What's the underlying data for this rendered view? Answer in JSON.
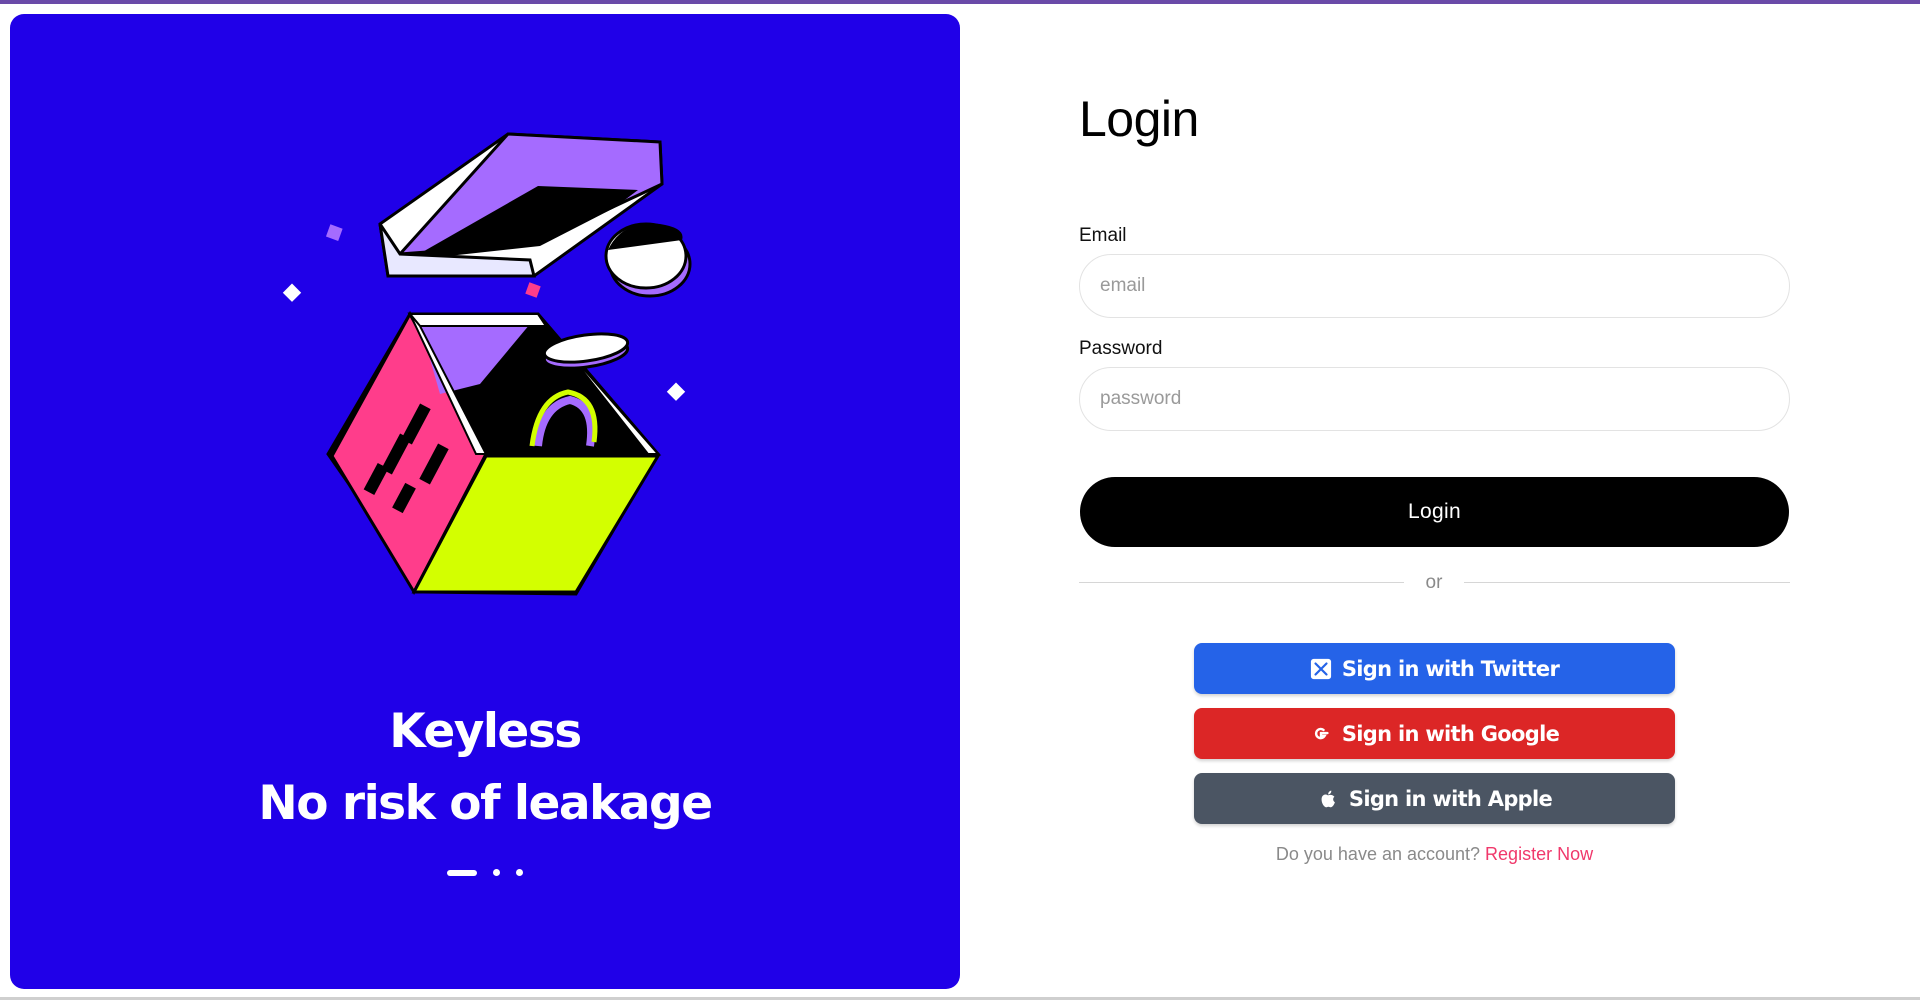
{
  "colors": {
    "hero_bg": "#2000e8",
    "login_button": "#000000",
    "twitter": "#2563e8",
    "google": "#dc2626",
    "apple": "#4b5563",
    "register_link": "#f0386b"
  },
  "hero": {
    "line1": "Keyless",
    "line2": "No risk of leakage",
    "carousel": {
      "slides": 3,
      "active": 1
    }
  },
  "login": {
    "title": "Login",
    "email_label": "Email",
    "email_placeholder": "email",
    "email_value": "",
    "password_label": "Password",
    "password_placeholder": "password",
    "password_value": "",
    "submit_label": "Login",
    "divider_text": "or"
  },
  "social": {
    "twitter": {
      "label": "Sign in with Twitter",
      "icon": "x-twitter-icon"
    },
    "google": {
      "label": "Sign in with Google",
      "icon": "google-icon"
    },
    "apple": {
      "label": "Sign in with Apple",
      "icon": "apple-icon"
    }
  },
  "register": {
    "prompt": "Do you have an account?",
    "link": "Register Now"
  }
}
